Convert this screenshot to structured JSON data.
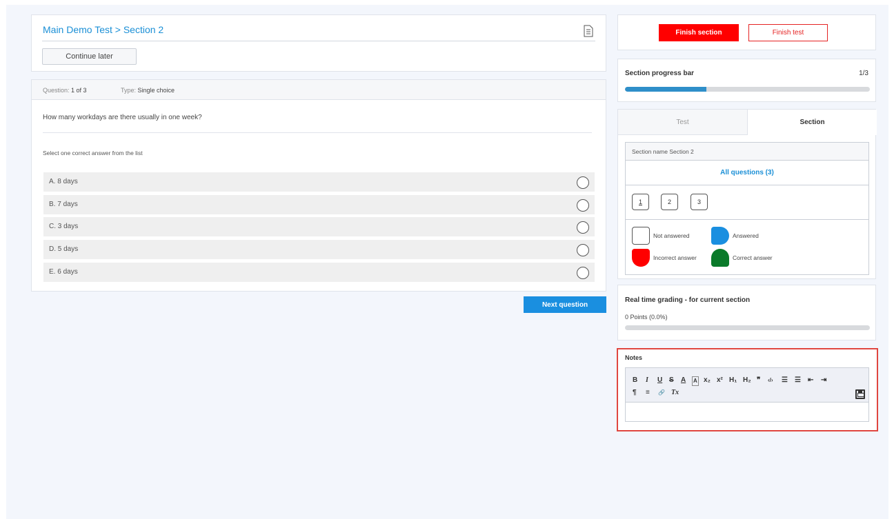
{
  "header": {
    "breadcrumb": "Main Demo Test > Section 2",
    "continue_later": "Continue later"
  },
  "question": {
    "meta_question_label": "Question:",
    "meta_question_value": "1 of 3",
    "meta_type_label": "Type:",
    "meta_type_value": "Single choice",
    "text": "How many workdays are there usually in one week?",
    "instruction": "Select one correct answer from the list",
    "answers": [
      {
        "label": "A.  8 days"
      },
      {
        "label": "B.  7 days"
      },
      {
        "label": "C.  3 days"
      },
      {
        "label": "D.  5 days"
      },
      {
        "label": "E.  6 days"
      }
    ],
    "next_button": "Next question"
  },
  "actions": {
    "finish_section": "Finish section",
    "finish_test": "Finish test"
  },
  "progress": {
    "title": "Section progress bar",
    "count": "1/3",
    "fraction": 0.333
  },
  "tabs": {
    "test": "Test",
    "section": "Section"
  },
  "section_panel": {
    "section_name": "Section name Section 2",
    "all_questions": "All questions (3)",
    "question_numbers": [
      "1",
      "2",
      "3"
    ],
    "legend": {
      "not_answered": "Not answered",
      "answered": "Answered",
      "incorrect": "Incorrect answer",
      "correct": "Correct answer"
    }
  },
  "grading": {
    "title": "Real time grading - for current section",
    "points": "0 Points (0.0%)",
    "fraction": 0.0
  },
  "notes": {
    "title": "Notes",
    "toolbar": [
      "B",
      "I",
      "U",
      "S",
      "A",
      "A",
      "x₂",
      "x²",
      "H₁",
      "H₂",
      "❞",
      "‹/›",
      "☰",
      "☰",
      "⇤",
      "⇥",
      "¶",
      "≡",
      "🔗",
      "Tx"
    ]
  },
  "colors": {
    "accent": "#1a8fd6",
    "danger": "#ff0000",
    "correct": "#0a7a2a",
    "answered": "#1a8fe0",
    "notes_border": "#e0463f"
  }
}
